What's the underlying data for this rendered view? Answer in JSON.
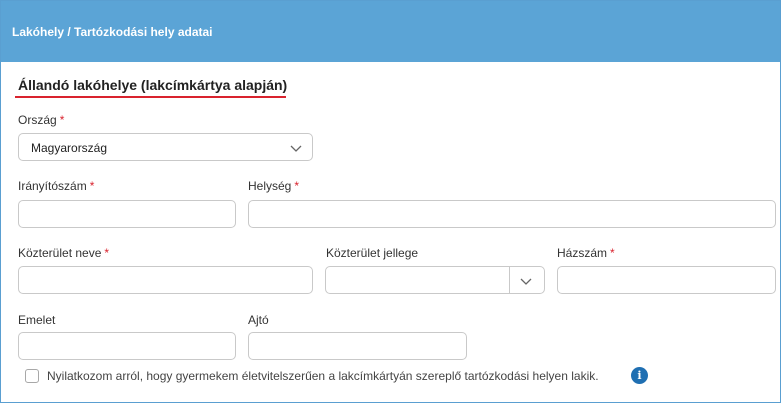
{
  "panel": {
    "title": "Lakóhely / Tartózkodási hely adatai"
  },
  "section": {
    "title": "Állandó lakóhelye (lakcímkártya alapján)"
  },
  "form": {
    "country": {
      "label": "Ország",
      "required_mark": "*",
      "value": "Magyarország"
    },
    "zip": {
      "label": "Irányítószám",
      "required_mark": "*",
      "value": ""
    },
    "city": {
      "label": "Helység",
      "required_mark": "*",
      "value": ""
    },
    "street_name": {
      "label": "Közterület neve",
      "required_mark": "*",
      "value": ""
    },
    "street_type": {
      "label": "Közterület jellege",
      "value": ""
    },
    "house_number": {
      "label": "Házszám",
      "required_mark": "*",
      "value": ""
    },
    "floor": {
      "label": "Emelet",
      "value": ""
    },
    "door": {
      "label": "Ajtó",
      "value": ""
    },
    "declaration": {
      "label": "Nyilatkozom arról, hogy gyermekem életvitelszerűen a lakcímkártyán szereplő tartózkodási helyen lakik.",
      "checked": false,
      "info_icon": "info-icon"
    }
  },
  "colors": {
    "header_bg": "#5ba4d6",
    "required": "#d9232e",
    "info": "#1f6fb2"
  }
}
